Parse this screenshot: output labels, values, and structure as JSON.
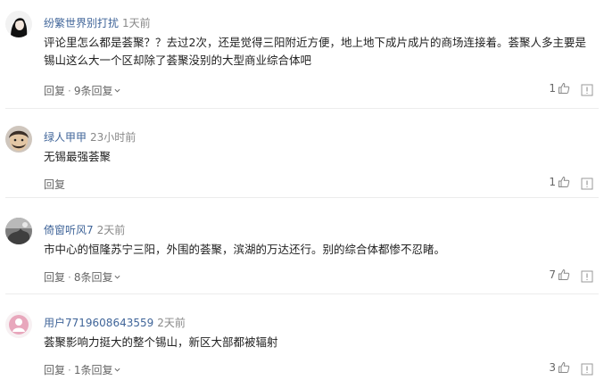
{
  "comments": [
    {
      "username": "纷繁世界别打扰",
      "time": "1天前",
      "text": "评论里怎么都是荟聚？？去过2次，还是觉得三阳附近方便，地上地下成片成片的商场连接着。荟聚人多主要是锡山这么大一个区却除了荟聚没别的大型商业综合体吧",
      "reply_label": "回复",
      "replies_label": "9条回复",
      "likes": "1"
    },
    {
      "username": "绿人甲甲",
      "time": "23小时前",
      "text": "无锡最强荟聚",
      "reply_label": "回复",
      "likes": "1"
    },
    {
      "username": "倚窗听风7",
      "time": "2天前",
      "text": "市中心的恒隆苏宁三阳，外围的荟聚，滨湖的万达还行。别的综合体都惨不忍睹。",
      "reply_label": "回复",
      "replies_label": "8条回复",
      "likes": "7"
    },
    {
      "username": "用户7719608643559",
      "time": "2天前",
      "text": "荟聚影响力挺大的整个锡山，新区大部都被辐射",
      "reply_label": "回复",
      "replies_label": "1条回复",
      "likes": "3"
    }
  ],
  "icons": {
    "chevron": "chevron-down-icon",
    "like": "thumbs-up-icon",
    "flag": "report-icon"
  },
  "colors": {
    "username": "#406599",
    "meta": "#888888",
    "action": "#666666"
  }
}
